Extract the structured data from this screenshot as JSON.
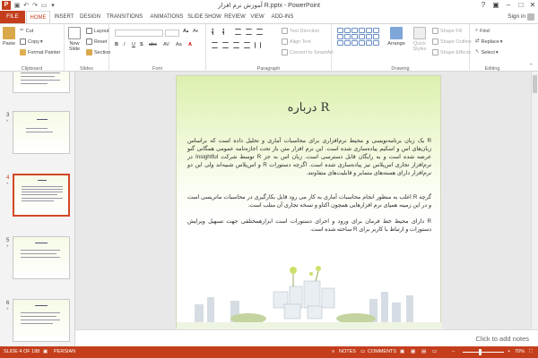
{
  "app": {
    "title": "آموزش نرم افزار R.pptx - PowerPoint",
    "icon_letter": "P",
    "accent": "#c43e1c"
  },
  "tabs": {
    "file": "FILE",
    "items": [
      "HOME",
      "INSERT",
      "DESIGN",
      "TRANSITIONS",
      "ANIMATIONS",
      "SLIDE SHOW",
      "REVIEW",
      "VIEW",
      "ADD-INS"
    ],
    "active": "HOME",
    "signin": "Sign in"
  },
  "ribbon": {
    "clipboard": {
      "paste": "Paste",
      "cut": "Cut",
      "copy": "Copy",
      "format_painter": "Format Painter",
      "label": "Clipboard"
    },
    "slides": {
      "new_slide": "New Slide",
      "layout": "Layout",
      "reset": "Reset",
      "section": "Section",
      "label": "Slides"
    },
    "font": {
      "label": "Font"
    },
    "paragraph": {
      "text_direction": "Text Direction",
      "align_text": "Align Text",
      "convert_smartart": "Convert to SmartArt",
      "label": "Paragraph"
    },
    "drawing": {
      "arrange": "Arrange",
      "quick_styles": "Quick Styles",
      "shape_fill": "Shape Fill",
      "shape_outline": "Shape Outline",
      "shape_effects": "Shape Effects",
      "label": "Drawing"
    },
    "editing": {
      "find": "Find",
      "replace": "Replace",
      "select": "Select",
      "label": "Editing"
    }
  },
  "thumbnails": [
    {
      "num": "3",
      "star": "*",
      "selected": false
    },
    {
      "num": "4",
      "star": "*",
      "selected": true
    },
    {
      "num": "5",
      "star": "*",
      "selected": false
    },
    {
      "num": "6",
      "star": "*",
      "selected": false
    }
  ],
  "slide": {
    "title": "درباره R",
    "paragraphs": [
      "R یک زبان برنامه‌نویسی و محیط نرم‌افزاری برای محاسبات آماری و تحلیل داده است که براساس زبان‌های اس و اسکیم پیاده‌سازی شده است. این نرم افزار متن باز تحت اجازه‌نامه عمومی همگانی گنو عرضه شده است و به رایگان قابل دسترسی است. زبان اس به جز R توسط شرکت Insightful در نرم‌افزار تجاری اس‌پلاس نیز پیاده‌سازی شده است. اگرچه دستورات R و اس‌پلاس شبیه‌اند ولی این دو نرم‌افزار دارای هسته‌های متمایز و قابلیت‌های متفاوتند.",
      "گرچه R اغلب به منظور انجام محاسبات آماری به کار می رود قابل بکارگیری در محاسبات ماتریسی است و در این زمینه همپای نرم افزارهایی همچون اکتاو و نسخه تجاری آن متلب است.",
      "R دارای محیط خط فرمان برای ورود و اجرای دستورات است ابزارهمختلفی جهت تسهیل ویرایش دستورات و ارتباط با کاربر برای R ساخته شده است."
    ]
  },
  "notes": {
    "placeholder": "Click to add notes"
  },
  "status": {
    "slide_of": "SLIDE 4 OF 188",
    "language": "PERSIAN",
    "notes_btn": "NOTES",
    "comments_btn": "COMMENTS",
    "zoom": "70%"
  }
}
